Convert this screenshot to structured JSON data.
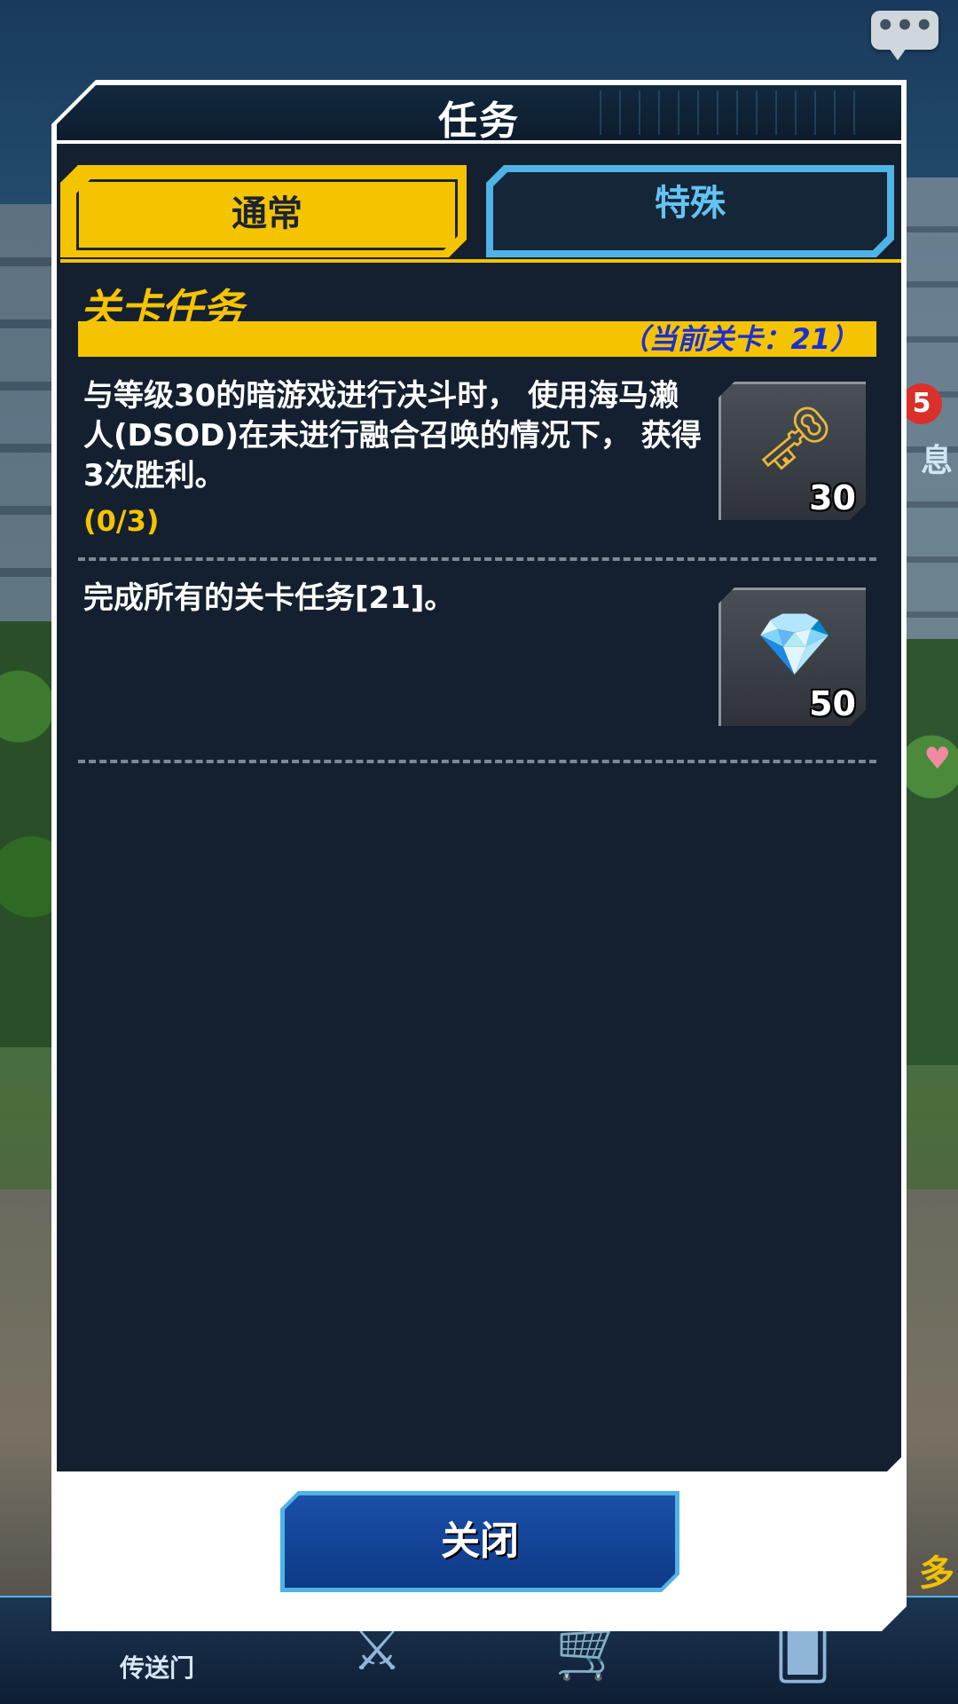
{
  "dialog": {
    "title": "任务"
  },
  "tabs": [
    {
      "label": "通常",
      "active": true
    },
    {
      "label": "特殊",
      "active": false
    }
  ],
  "section": {
    "title": "关卡任务",
    "stage_info": "（当前关卡：21）"
  },
  "missions": [
    {
      "text": "与等级30的暗游戏进行决斗时， 使用海马濑人(DSOD)在未进行融合召唤的情况下， 获得3次胜利。",
      "progress": "(0/3)",
      "reward_icon": "key-icon",
      "reward_count": "30"
    },
    {
      "text": "完成所有的关卡任务[21]。",
      "reward_icon": "gem-icon",
      "reward_count": "50"
    }
  ],
  "close_button": {
    "label": "关闭"
  },
  "background": {
    "nav_label": "传送门",
    "badge_count": "5",
    "side_text_top": "息",
    "side_text_bottom": "多"
  },
  "colors": {
    "accent_yellow": "#f5c400",
    "accent_blue": "#4fb3e6",
    "panel_bg": "#14202f",
    "stage_text": "#1c2fd0"
  }
}
